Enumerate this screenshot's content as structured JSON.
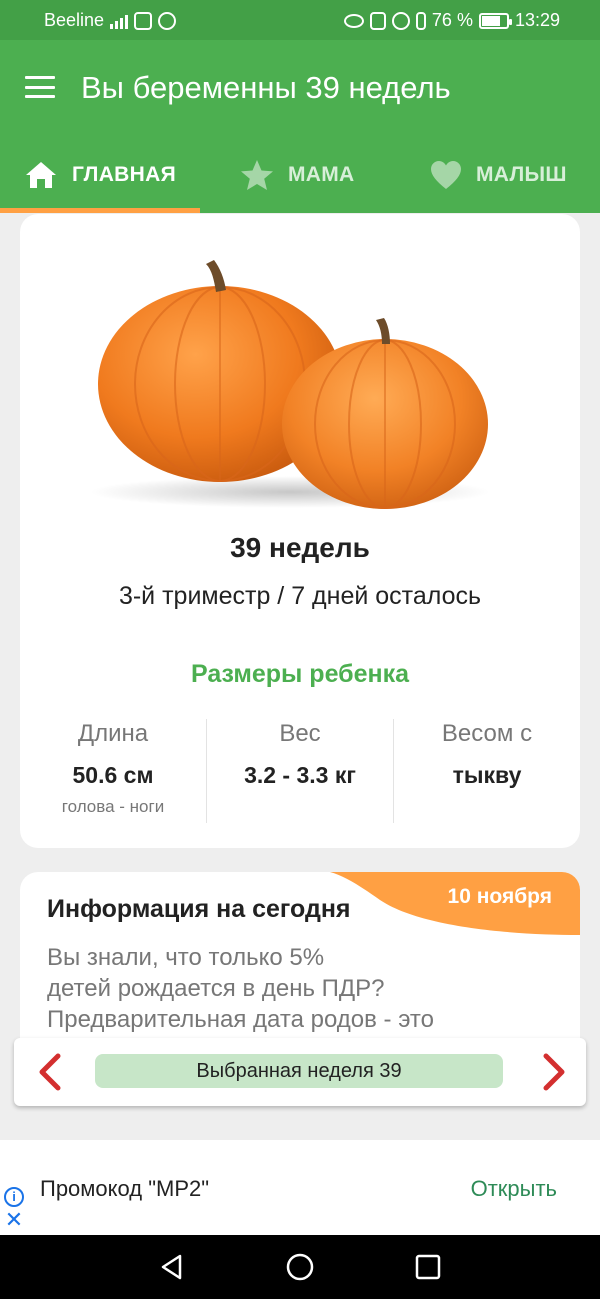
{
  "status_bar": {
    "carrier": "Beeline",
    "battery_percent": "76 %",
    "battery_level": 0.76,
    "time": "13:29"
  },
  "app_bar": {
    "title": "Вы беременны 39 недель"
  },
  "tabs": [
    {
      "label": "ГЛАВНАЯ",
      "icon": "home-icon",
      "selected": true
    },
    {
      "label": "МАМА",
      "icon": "star-icon",
      "selected": false
    },
    {
      "label": "МАЛЫШ",
      "icon": "heart-icon",
      "selected": false
    }
  ],
  "week_card": {
    "image": "pumpkins",
    "title": "39 недель",
    "subtitle": "3-й триместр / 7 дней осталось",
    "sizes_title": "Размеры ребенка",
    "stats": [
      {
        "label": "Длина",
        "value": "50.6 см",
        "note": "голова - ноги"
      },
      {
        "label": "Вес",
        "value": "3.2 - 3.3 кг",
        "note": ""
      },
      {
        "label": "Весом с",
        "value": "тыкву",
        "note": ""
      }
    ]
  },
  "info_card": {
    "date": "10 ноября",
    "title": "Информация на сегодня",
    "body_lines": [
      "Вы знали, что только 5%",
      "детей рождается в день ПДР?",
      "Предварительная дата родов - это"
    ]
  },
  "week_selector": {
    "label": "Выбранная неделя 39"
  },
  "ad": {
    "text": "Промокод \"МР2\"",
    "action": "Открыть"
  },
  "colors": {
    "primary": "#4caf50",
    "status_bar": "#43a047",
    "accent": "#ffa043",
    "arrow": "#d32f2f"
  }
}
